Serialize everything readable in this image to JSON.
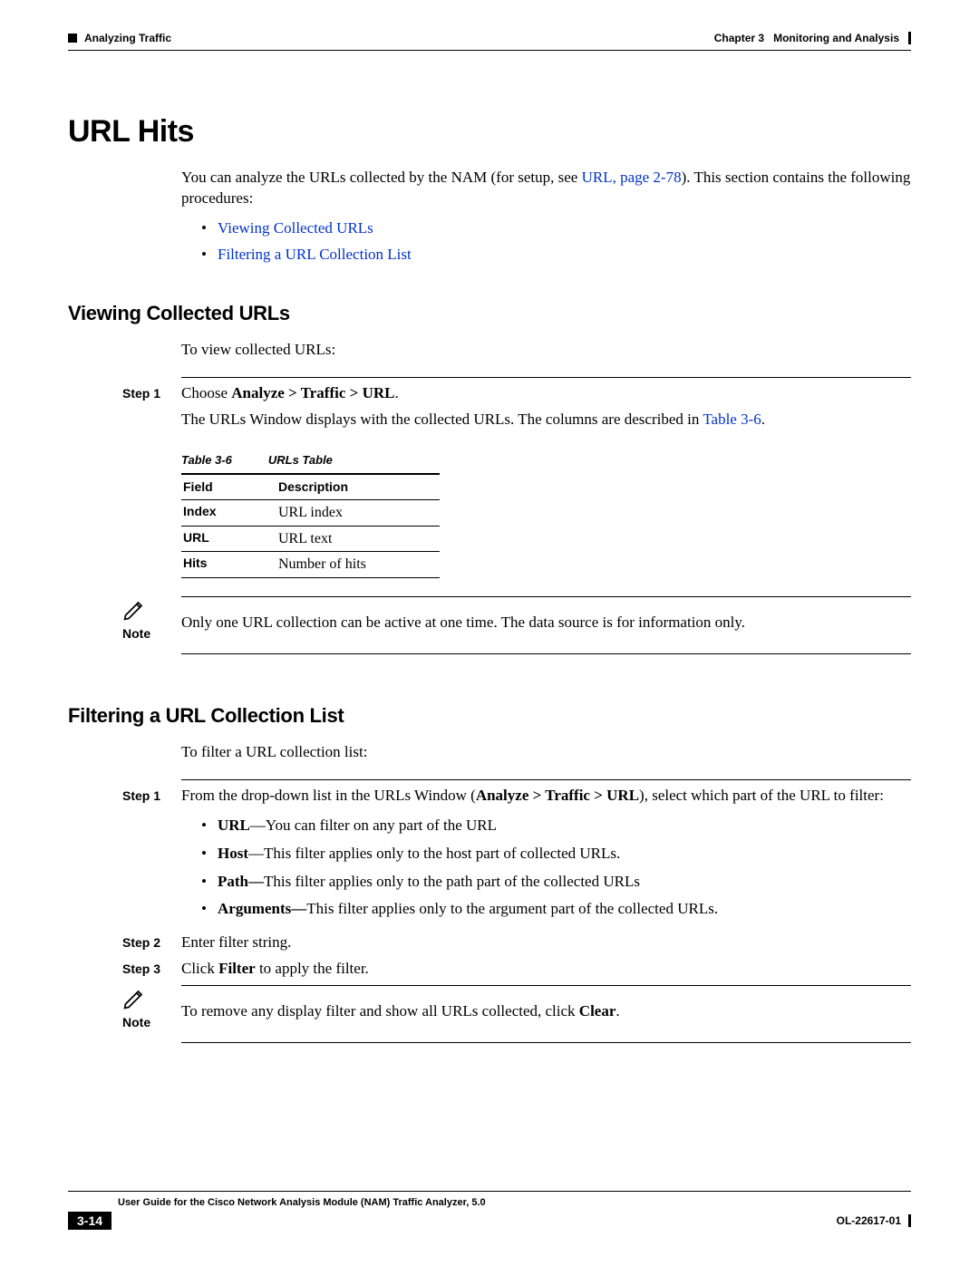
{
  "header": {
    "left_section": "Analyzing Traffic",
    "right_chapter": "Chapter 3",
    "right_title": "Monitoring and Analysis"
  },
  "h1": "URL Hits",
  "intro": {
    "text_before_link": "You can analyze the URLs collected by the NAM (for setup, see ",
    "link": "URL, page 2-78",
    "text_after_link": "). This section contains the following procedures:",
    "bullets": {
      "b1": "Viewing Collected URLs",
      "b2": "Filtering a URL Collection List"
    }
  },
  "section1": {
    "heading": "Viewing Collected URLs",
    "intro": "To view collected URLs:",
    "step1_label": "Step 1",
    "step1_pre": "Choose ",
    "step1_bold": "Analyze > Traffic > URL",
    "step1_post": ".",
    "desc_pre": "The URLs Window displays with the collected URLs. The columns are described in ",
    "desc_link": "Table 3-6",
    "desc_post": ".",
    "table_caption_id": "Table 3-6",
    "table_caption_name": "URLs Table",
    "table": {
      "h1": "Field",
      "h2": "Description",
      "r1c1": "Index",
      "r1c2": "URL index",
      "r2c1": "URL",
      "r2c2": "URL text",
      "r3c1": "Hits",
      "r3c2": "Number of hits"
    },
    "note_label": "Note",
    "note_text": "Only one URL collection can be active at one time. The data source is for information only."
  },
  "section2": {
    "heading": "Filtering a URL Collection List",
    "intro": "To filter a URL collection list:",
    "step1_label": "Step 1",
    "step1_pre": "From the drop-down list in the URLs Window (",
    "step1_bold": "Analyze > Traffic > URL",
    "step1_post": "), select which part of the URL to filter:",
    "bullets": {
      "b1_bold": "URL",
      "b1_rest": "—You can filter on any part of the URL",
      "b2_bold": "Host",
      "b2_rest": "—This filter applies only to the host part of collected URLs.",
      "b3_bold": "Path—",
      "b3_rest": "This filter applies only to the path part of the collected URLs",
      "b4_bold": "Arguments—",
      "b4_rest": "This filter applies only to the argument part of the collected URLs."
    },
    "step2_label": "Step 2",
    "step2_text": "Enter filter string.",
    "step3_label": "Step 3",
    "step3_pre": "Click ",
    "step3_bold": "Filter",
    "step3_post": " to apply the filter.",
    "note_label": "Note",
    "note_pre": "To remove any display filter and show all URLs collected, click ",
    "note_bold": "Clear",
    "note_post": "."
  },
  "footer": {
    "guide": "User Guide for the Cisco Network Analysis Module (NAM) Traffic Analyzer, 5.0",
    "page": "3-14",
    "doc_id": "OL-22617-01"
  }
}
